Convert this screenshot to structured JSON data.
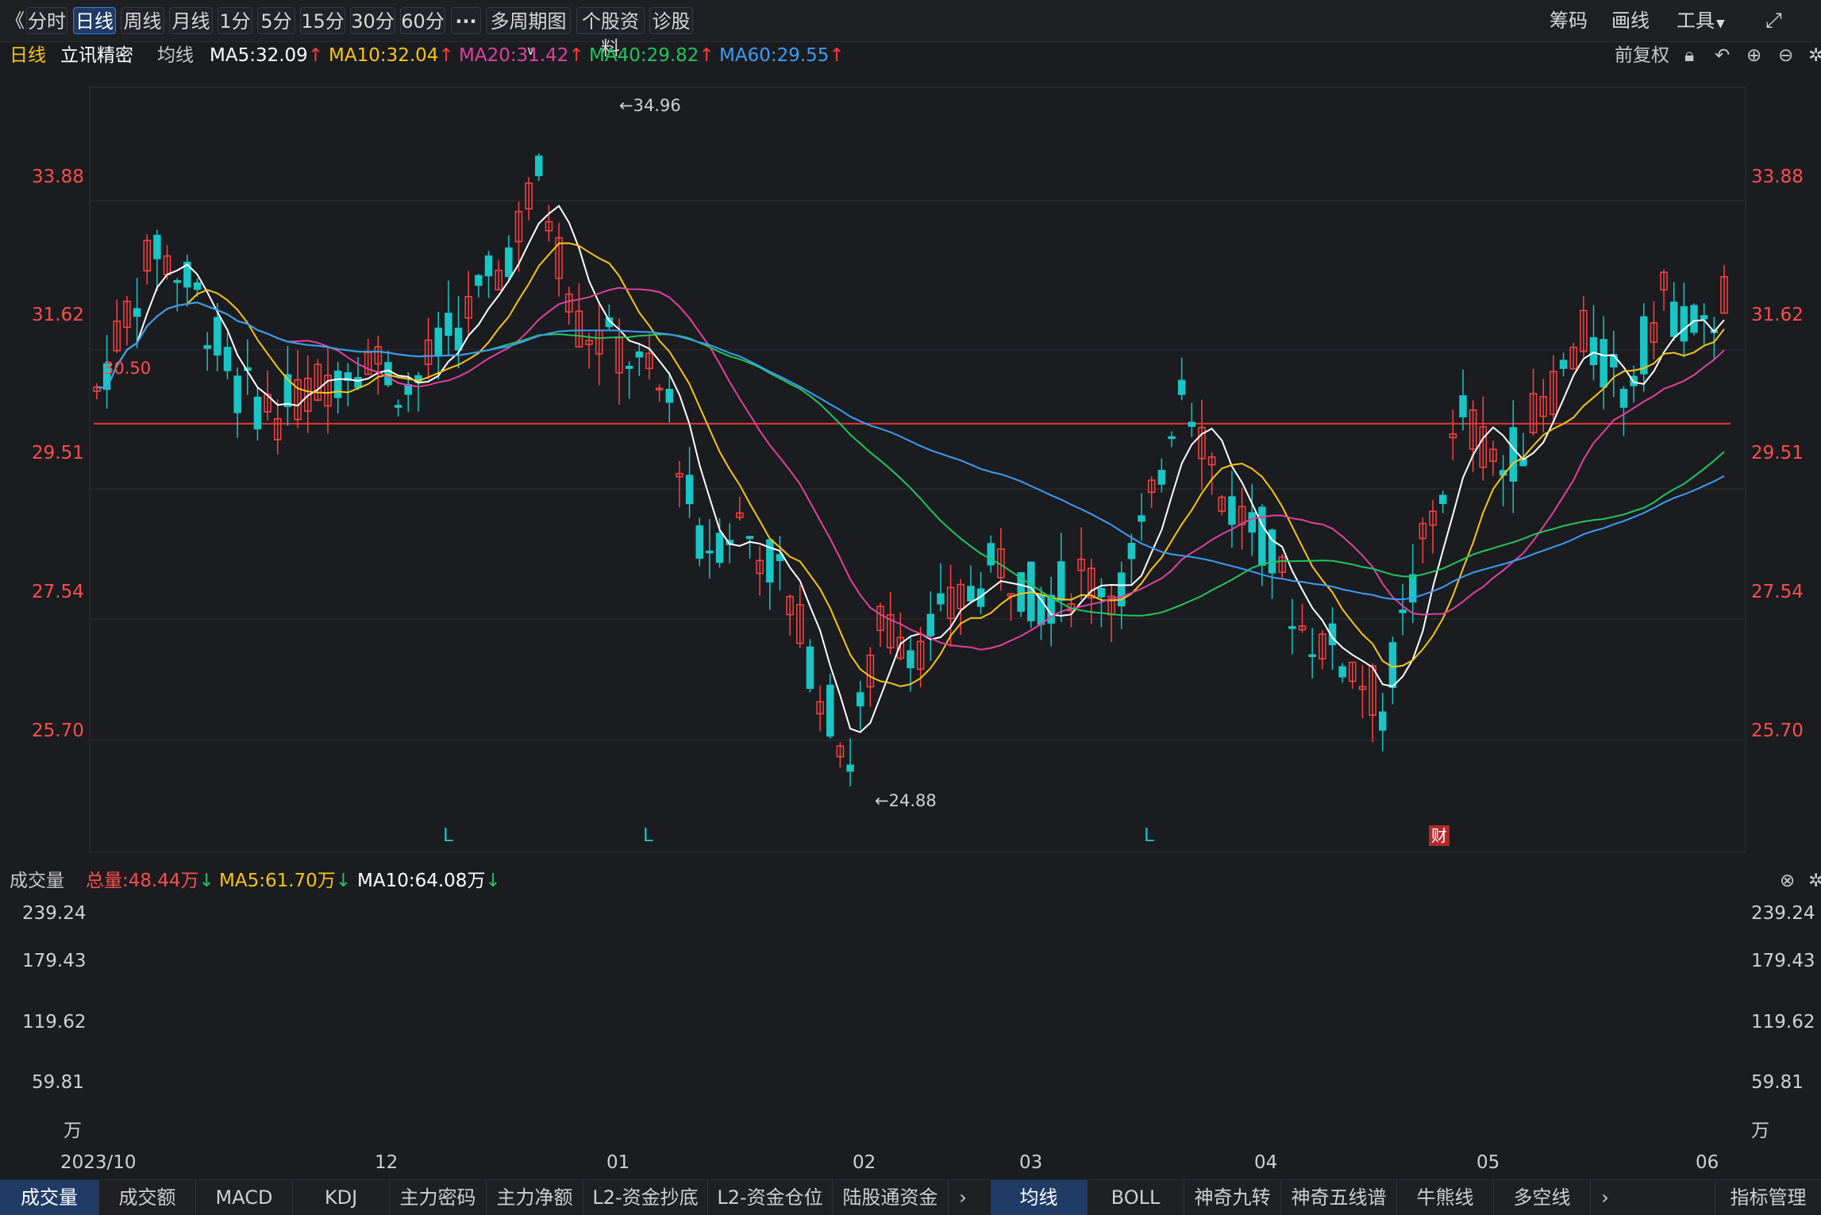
{
  "toolbar": {
    "collapse_icon": "double-chevron-left-icon",
    "periods": [
      "分时",
      "日线",
      "周线",
      "月线",
      "1分",
      "5分",
      "15分",
      "30分",
      "60分"
    ],
    "active_period": "日线",
    "more_label": "···",
    "multi_period_label": "多周期图",
    "profile_label": "个股资料",
    "diagnose_label": "诊股",
    "right_items": [
      "筹码",
      "画线",
      "工具"
    ],
    "fullscreen_icon": "fullscreen-icon"
  },
  "ma_legend": {
    "period_label": "日线",
    "stock_name": "立讯精密",
    "group_label": "均线",
    "ma5": "MA5:32.09",
    "ma10": "MA10:32.04",
    "ma20": "MA20:31.42",
    "ma40": "MA40:29.82",
    "ma60": "MA60:29.55",
    "adjust_label": "前复权",
    "colors": {
      "ma5": "#ffffff",
      "ma10": "#f5c518",
      "ma20": "#e040a0",
      "ma40": "#22c55e",
      "ma60": "#3b9cf5"
    }
  },
  "price_axis": {
    "ticks": [
      "33.88",
      "31.62",
      "29.51",
      "27.54",
      "25.70"
    ],
    "high_marker": "←34.96",
    "low_marker": "←24.88",
    "ref_line_label": "30.50",
    "signals": [
      "L",
      "L",
      "L"
    ],
    "event_badge": "财"
  },
  "volume": {
    "title": "成交量",
    "total": "总量:48.44万",
    "ma5": "MA5:61.70万",
    "ma10": "MA10:64.08万",
    "ticks": [
      "239.24",
      "179.43",
      "119.62",
      "59.81",
      "万"
    ]
  },
  "dates": [
    "2023/10",
    "12",
    "01",
    "02",
    "03",
    "04",
    "05",
    "06"
  ],
  "bottom_tabs_left": [
    "成交量",
    "成交额",
    "MACD",
    "KDJ",
    "主力密码",
    "主力净额",
    "L2-资金抄底",
    "L2-资金仓位",
    "陆股通资金"
  ],
  "bottom_tabs_right": [
    "均线",
    "BOLL",
    "神奇九转",
    "神奇五线谱",
    "牛熊线",
    "多空线"
  ],
  "indicator_manage": "指标管理",
  "chart_data": {
    "type": "candlestick",
    "title": "立讯精密 日线",
    "ylim": [
      24.0,
      35.6
    ],
    "x_range": [
      "2023/10",
      "06"
    ],
    "reference_line": 30.5,
    "high": 34.96,
    "low": 24.88,
    "ma_last": {
      "MA5": 32.09,
      "MA10": 32.04,
      "MA20": 31.42,
      "MA40": 29.82,
      "MA60": 29.55
    },
    "volume_ylim": [
      0,
      239.24
    ],
    "volume_unit": "万"
  }
}
